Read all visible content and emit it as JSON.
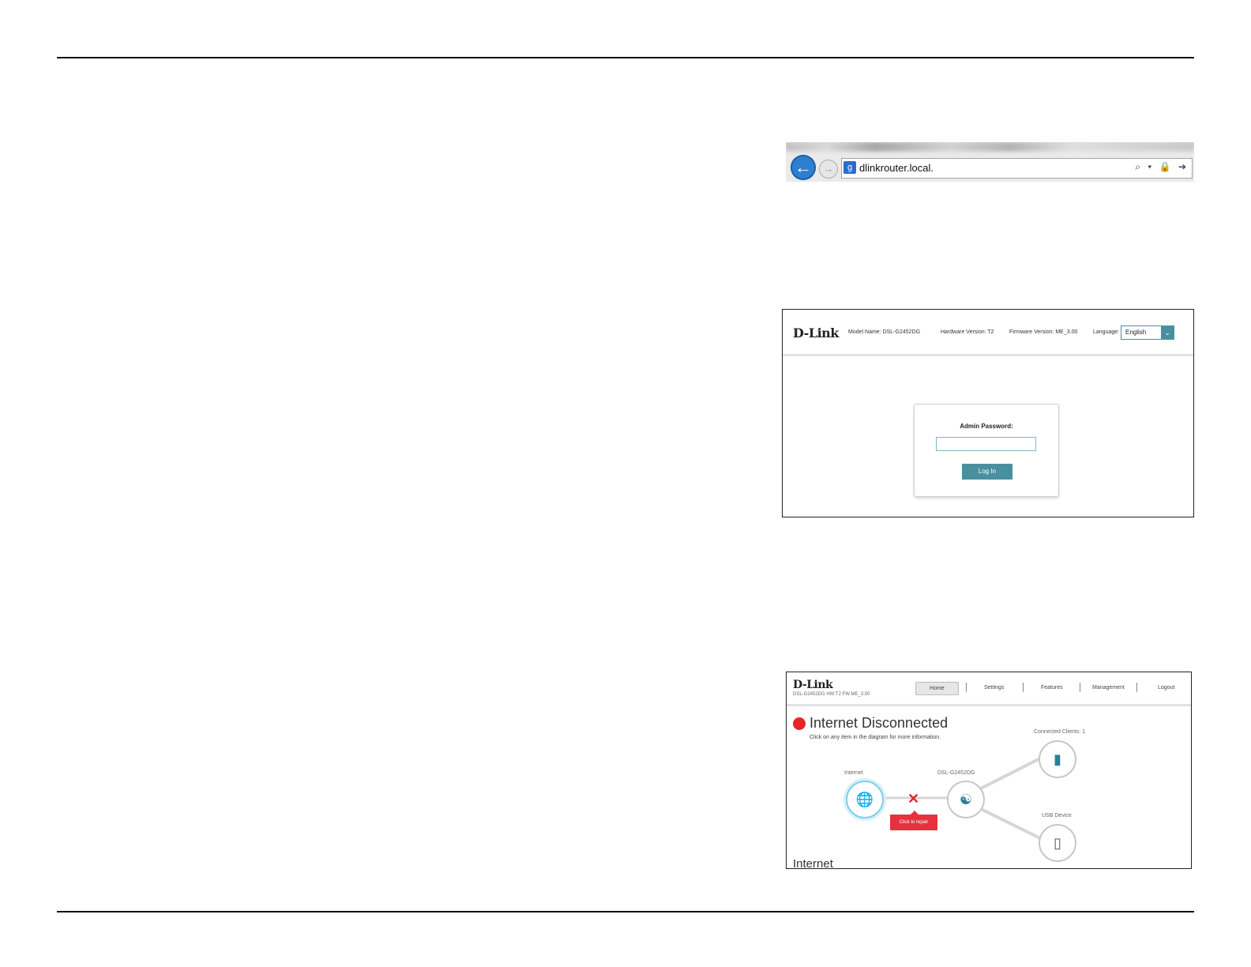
{
  "browser": {
    "url": "dlinkrouter.local.",
    "back_icon": "back-arrow-icon",
    "forward_icon": "forward-arrow-icon",
    "site_icon": "g",
    "tools": "⌕ ▾ 🔒 ➔"
  },
  "login_page": {
    "model_name": "Model Name: DSL-G2452DG",
    "hardware_version": "Hardware Version: T2",
    "firmware_version": "Firmware Version: ME_3.00",
    "language_label": "Language:",
    "language_value": "English",
    "password_label": "Admin Password:",
    "password_value": "",
    "login_button": "Log In",
    "accent_color": "#4a8fa0"
  },
  "home_page": {
    "subinfo": "DSL-G2452DG  HW:T2  FW:ME_3.00",
    "nav": [
      "Home",
      "Settings",
      "Features",
      "Management",
      "Logout"
    ],
    "status_title": "Internet Disconnected",
    "status_subtitle": "Click on any item in the diagram for more information.",
    "status_color": "#e5242b",
    "internet_label": "Internet",
    "router_label": "DSL-G2452DG",
    "clients_label": "Connected Clients: 1",
    "usb_label": "USB Device",
    "repair_label": "Click to repair",
    "section_title": "Internet"
  },
  "logo_text": "D-Link"
}
